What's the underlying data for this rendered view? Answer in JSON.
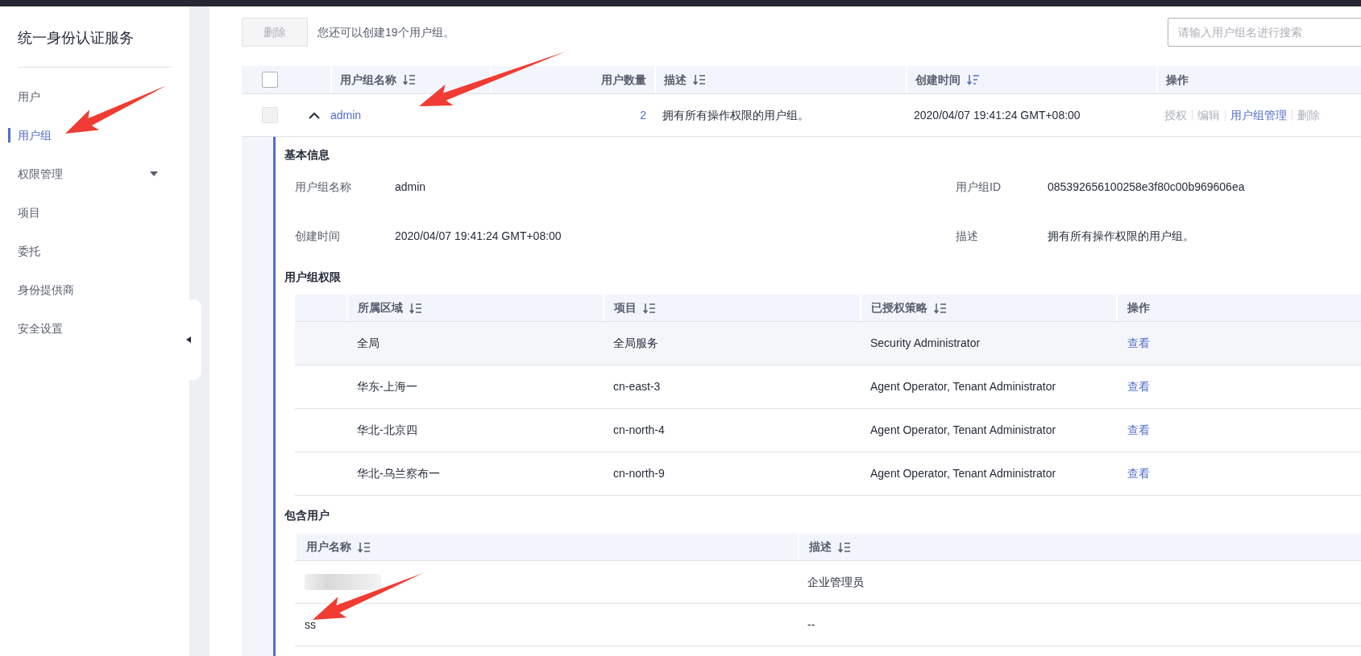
{
  "sidebar": {
    "title": "统一身份认证服务",
    "items": [
      {
        "label": "用户",
        "selected": false,
        "kind": "link"
      },
      {
        "label": "用户组",
        "selected": true,
        "kind": "link"
      },
      {
        "label": "权限管理",
        "selected": false,
        "kind": "group"
      },
      {
        "label": "项目",
        "selected": false,
        "kind": "link"
      },
      {
        "label": "委托",
        "selected": false,
        "kind": "link"
      },
      {
        "label": "身份提供商",
        "selected": false,
        "kind": "link"
      },
      {
        "label": "安全设置",
        "selected": false,
        "kind": "link"
      }
    ]
  },
  "toolbar": {
    "delete_button": {
      "label": "删除",
      "disabled": true
    },
    "quota_text": "您还可以创建19个用户组。",
    "search": {
      "placeholder": "请输入用户组名进行搜索"
    }
  },
  "groups_table": {
    "header_checked": false,
    "columns": [
      {
        "label": "用户组名称",
        "sortable": true,
        "sorted": false,
        "kind": "text"
      },
      {
        "label": "用户数量",
        "sortable": false,
        "kind": "number"
      },
      {
        "label": "描述",
        "sortable": true,
        "sorted": false,
        "kind": "text"
      },
      {
        "label": "创建时间",
        "sortable": true,
        "sorted": true,
        "kind": "text"
      },
      {
        "label": "操作",
        "sortable": false,
        "kind": "text"
      }
    ],
    "rows": [
      {
        "disabled": true,
        "expanded": true,
        "name": "admin",
        "user_count": "2",
        "description": "拥有所有操作权限的用户组。",
        "created": "2020/04/07 19:41:24 GMT+08:00",
        "actions": [
          {
            "label": "授权",
            "disabled": true
          },
          {
            "label": "编辑",
            "disabled": true
          },
          {
            "label": "用户组管理",
            "disabled": false
          },
          {
            "label": "删除",
            "disabled": true
          }
        ]
      }
    ]
  },
  "detail": {
    "basic_info": {
      "title": "基本信息",
      "fields": [
        {
          "label": "用户组名称",
          "value": "admin"
        },
        {
          "label": "用户组ID",
          "value": "085392656100258e3f80c00b969606ea"
        },
        {
          "label": "创建时间",
          "value": "2020/04/07 19:41:24 GMT+08:00"
        },
        {
          "label": "描述",
          "value": "拥有所有操作权限的用户组。"
        }
      ]
    },
    "permissions": {
      "title": "用户组权限",
      "columns": [
        {
          "label": "所属区域",
          "sortable": true,
          "sorted": false
        },
        {
          "label": "项目",
          "sortable": true,
          "sorted": false
        },
        {
          "label": "已授权策略",
          "sortable": true,
          "sorted": false
        },
        {
          "label": "操作",
          "sortable": false
        }
      ],
      "rows": [
        {
          "hovered": true,
          "region": "全局",
          "project": "全局服务",
          "policies": "Security Administrator",
          "action": "查看"
        },
        {
          "hovered": false,
          "region": "华东-上海一",
          "project": "cn-east-3",
          "policies": "Agent Operator, Tenant Administrator",
          "action": "查看"
        },
        {
          "hovered": false,
          "region": "华北-北京四",
          "project": "cn-north-4",
          "policies": "Agent Operator, Tenant Administrator",
          "action": "查看"
        },
        {
          "hovered": false,
          "region": "华北-乌兰察布一",
          "project": "cn-north-9",
          "policies": "Agent Operator, Tenant Administrator",
          "action": "查看"
        }
      ]
    },
    "users": {
      "title": "包含用户",
      "columns": [
        {
          "label": "用户名称",
          "sortable": true,
          "sorted": false
        },
        {
          "label": "描述",
          "sortable": true,
          "sorted": false
        }
      ],
      "rows": [
        {
          "kind": "redacted",
          "description": "企业管理员"
        },
        {
          "kind": "text",
          "name": "ss",
          "description": "--"
        }
      ]
    }
  }
}
